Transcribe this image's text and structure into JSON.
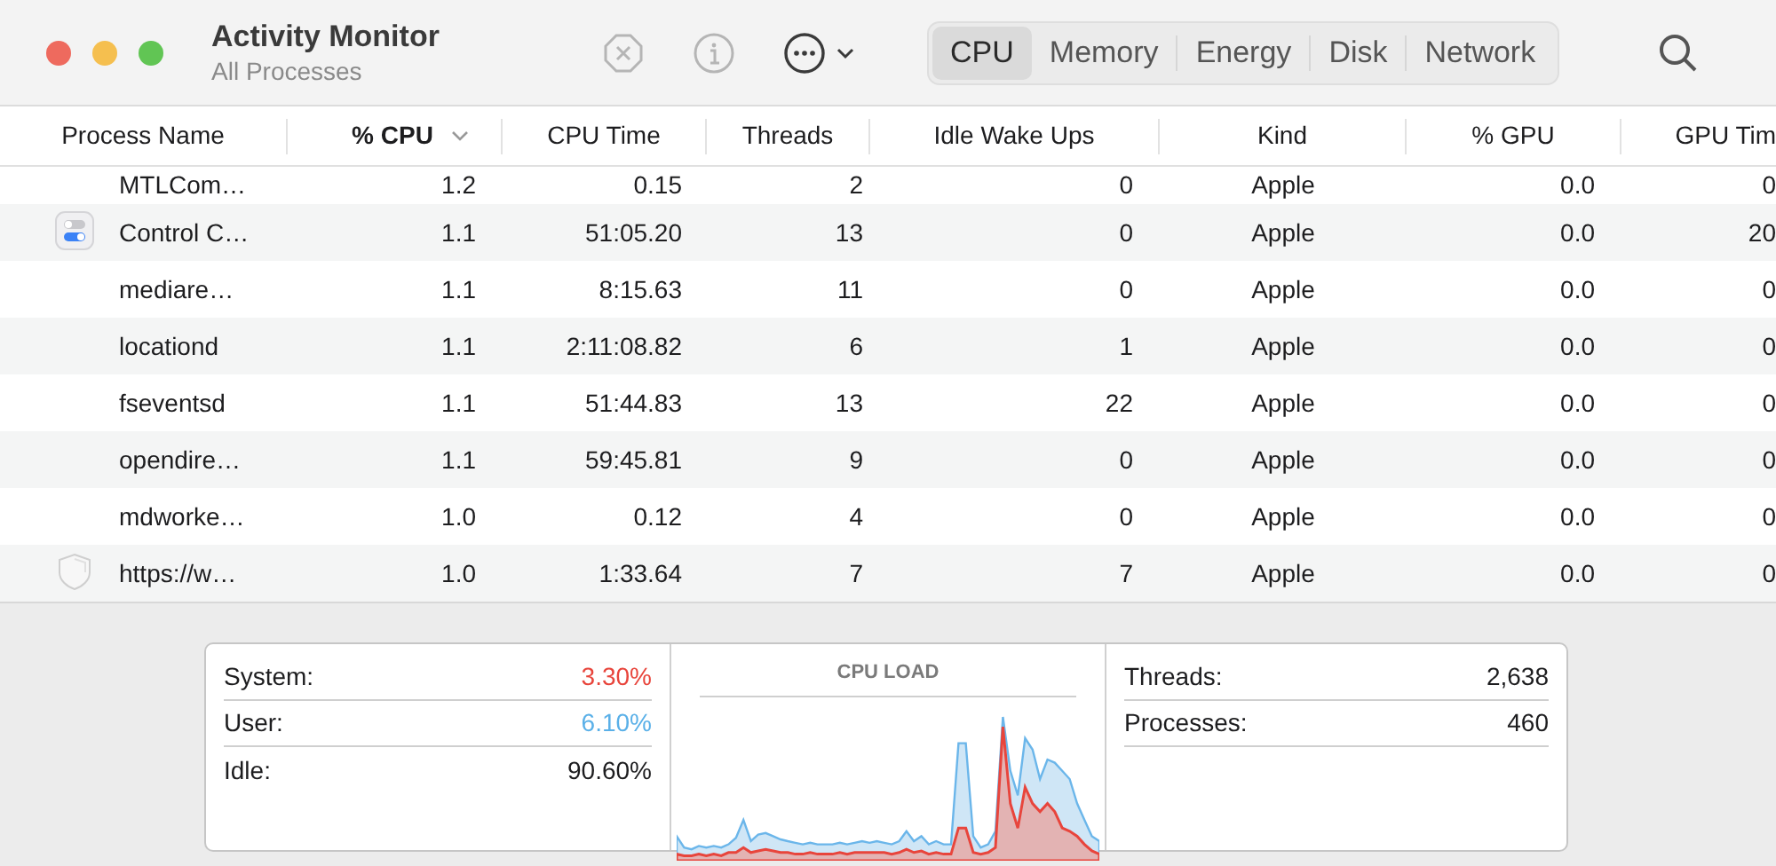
{
  "window": {
    "title": "Activity Monitor",
    "subtitle": "All Processes"
  },
  "toolbar": [
    {
      "kind": "stop",
      "disabled": true
    },
    {
      "kind": "info",
      "disabled": true
    },
    {
      "kind": "more",
      "disabled": false
    }
  ],
  "tabs": [
    {
      "label": "CPU",
      "selected": true
    },
    {
      "label": "Memory",
      "selected": false
    },
    {
      "label": "Energy",
      "selected": false
    },
    {
      "label": "Disk",
      "selected": false
    },
    {
      "label": "Network",
      "selected": false
    }
  ],
  "table": {
    "columns": [
      {
        "label": "Process Name",
        "sorted": false
      },
      {
        "label": "% CPU",
        "sorted": true
      },
      {
        "label": "CPU Time",
        "sorted": false
      },
      {
        "label": "Threads",
        "sorted": false
      },
      {
        "label": "Idle Wake Ups",
        "sorted": false
      },
      {
        "label": "Kind",
        "sorted": false
      },
      {
        "label": "% GPU",
        "sorted": false
      },
      {
        "label": "GPU Tim",
        "sorted": false
      }
    ],
    "rows": [
      {
        "kind": "plain",
        "cells": [
          "MTLCom…",
          "1.2",
          "0.15",
          "2",
          "0",
          "Apple",
          "0.0",
          "0"
        ]
      },
      {
        "kind": "toggles",
        "cells": [
          "Control C…",
          "1.1",
          "51:05.20",
          "13",
          "0",
          "Apple",
          "0.0",
          "20"
        ]
      },
      {
        "kind": "plain",
        "cells": [
          "mediare…",
          "1.1",
          "8:15.63",
          "11",
          "0",
          "Apple",
          "0.0",
          "0"
        ]
      },
      {
        "kind": "plain",
        "cells": [
          "locationd",
          "1.1",
          "2:11:08.82",
          "6",
          "1",
          "Apple",
          "0.0",
          "0"
        ]
      },
      {
        "kind": "plain",
        "cells": [
          "fseventsd",
          "1.1",
          "51:44.83",
          "13",
          "22",
          "Apple",
          "0.0",
          "0"
        ]
      },
      {
        "kind": "plain",
        "cells": [
          "opendire…",
          "1.1",
          "59:45.81",
          "9",
          "0",
          "Apple",
          "0.0",
          "0"
        ]
      },
      {
        "kind": "plain",
        "cells": [
          "mdworke…",
          "1.0",
          "0.12",
          "4",
          "0",
          "Apple",
          "0.0",
          "0"
        ]
      },
      {
        "kind": "shield",
        "cells": [
          "https://w…",
          "1.0",
          "1:33.64",
          "7",
          "7",
          "Apple",
          "0.0",
          "0"
        ]
      }
    ]
  },
  "summary": {
    "stats": [
      {
        "label": "System:",
        "value": "3.30%",
        "color": "#e8453c"
      },
      {
        "label": "User:",
        "value": "6.10%",
        "color": "#5ab0e8"
      },
      {
        "label": "Idle:",
        "value": "90.60%",
        "color": "#1d1d1f"
      }
    ],
    "graph_title": "CPU LOAD",
    "counts": [
      {
        "label": "Threads:",
        "value": "2,638"
      },
      {
        "label": "Processes:",
        "value": "460"
      }
    ]
  }
}
